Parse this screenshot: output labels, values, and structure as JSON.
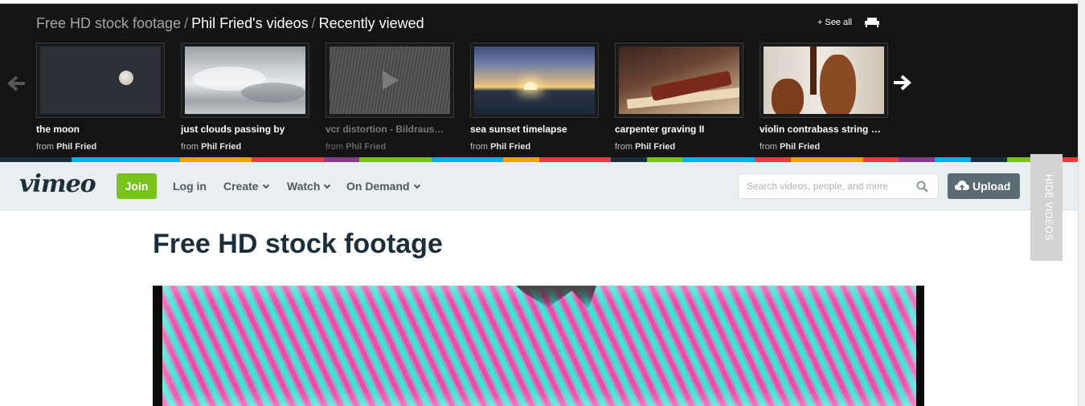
{
  "recently_viewed": {
    "breadcrumbs": [
      "Free HD stock footage",
      "Phil Fried's videos",
      "Recently viewed"
    ],
    "separator": "/",
    "see_all": "+ See all",
    "items": [
      {
        "title": "the moon",
        "from_label": "from",
        "author": "Phil Fried"
      },
      {
        "title": "just clouds passing by",
        "from_label": "from",
        "author": "Phil Fried"
      },
      {
        "title": "vcr distortion - Bildraus…",
        "from_label": "from",
        "author": "Phil Fried"
      },
      {
        "title": "sea sunset timelapse",
        "from_label": "from",
        "author": "Phil Fried"
      },
      {
        "title": "carpenter graving II",
        "from_label": "from",
        "author": "Phil Fried"
      },
      {
        "title": "violin contrabass string …",
        "from_label": "from",
        "author": "Phil Fried"
      }
    ]
  },
  "stripe_colors": [
    "#1a2e3b",
    "#1a2e3b",
    "#00adef",
    "#00adef",
    "#00adef",
    "#f0a000",
    "#f0a000",
    "#e53f3f",
    "#e53f3f",
    "#8b3a8b",
    "#7ac31c",
    "#7ac31c",
    "#00adef",
    "#00adef",
    "#f0a000",
    "#e53f3f",
    "#e53f3f",
    "#1a2e3b",
    "#7ac31c",
    "#00adef",
    "#00adef",
    "#e53f3f",
    "#f0a000",
    "#f0a000",
    "#e53f3f",
    "#8b3a8b",
    "#00adef",
    "#1a2e3b",
    "#7ac31c",
    "#e53f3f"
  ],
  "header": {
    "logo": "vimeo",
    "join": "Join",
    "login": "Log in",
    "nav": [
      "Create",
      "Watch",
      "On Demand"
    ],
    "search_placeholder": "Search videos, people, and more",
    "upload": "Upload",
    "hide_videos": "HIDE VIDEOS"
  },
  "main": {
    "title": "Free HD stock footage"
  },
  "colors": {
    "join_green": "#7ac31c",
    "header_bg": "#e9eef0",
    "dark_strip": "#141414",
    "title_color": "#1a2e3b"
  }
}
